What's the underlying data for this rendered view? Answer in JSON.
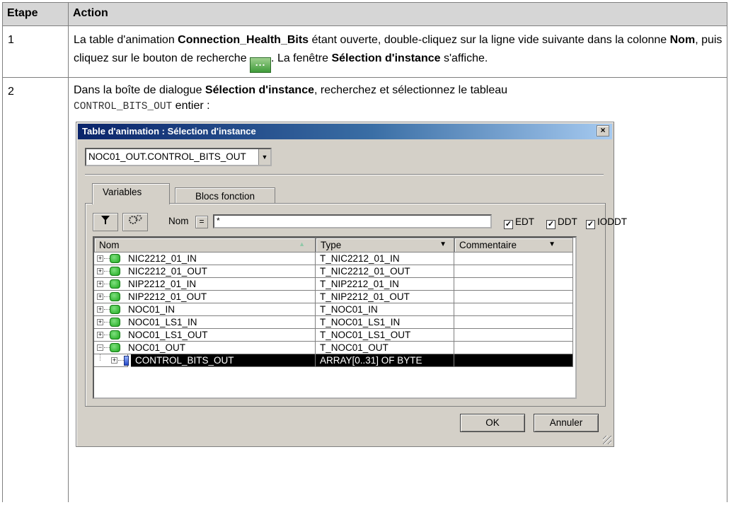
{
  "table": {
    "header": {
      "step": "Etape",
      "action": "Action"
    },
    "row1": {
      "step": "1",
      "t1": "La table d'animation ",
      "b1": "Connection_Health_Bits",
      "t2": " étant ouverte, double-cliquez sur la ligne vide suivante dans la colonne ",
      "b2": "Nom",
      "t3": ", puis cliquez sur le bouton de recherche ",
      "btn": "...",
      "t4": ". La fenêtre ",
      "b3": "Sélection d'instance",
      "t5": " s'affiche."
    },
    "row2": {
      "step": "2",
      "t1": "Dans la boîte de dialogue ",
      "b1": "Sélection d'instance",
      "t2": ", recherchez et sélectionnez le tableau",
      "code": "CONTROL_BITS_OUT",
      "t3": " entier :"
    }
  },
  "dialog": {
    "title": "Table d'animation : Sélection d'instance",
    "close": "×",
    "combo_value": "NOC01_OUT.CONTROL_BITS_OUT",
    "tabs": [
      "Variables",
      "Blocs fonction"
    ],
    "filter_label": "Nom",
    "eq_label": "=",
    "filter_value": "*",
    "checkboxes": [
      {
        "label": "EDT",
        "checked": true
      },
      {
        "label": "DDT",
        "checked": true
      },
      {
        "label": "IODDT",
        "checked": true
      }
    ],
    "columns": [
      "Nom",
      "Type",
      "Commentaire"
    ],
    "rows": [
      {
        "name": "NIC2212_01_IN",
        "type": "T_NIC2212_01_IN"
      },
      {
        "name": "NIC2212_01_OUT",
        "type": "T_NIC2212_01_OUT"
      },
      {
        "name": "NIP2212_01_IN",
        "type": "T_NIP2212_01_IN"
      },
      {
        "name": "NIP2212_01_OUT",
        "type": "T_NIP2212_01_OUT"
      },
      {
        "name": "NOC01_IN",
        "type": "T_NOC01_IN"
      },
      {
        "name": "NOC01_LS1_IN",
        "type": "T_NOC01_LS1_IN"
      },
      {
        "name": "NOC01_LS1_OUT",
        "type": "T_NOC01_LS1_OUT"
      },
      {
        "name": "NOC01_OUT",
        "type": "T_NOC01_OUT"
      },
      {
        "name": "CONTROL_BITS_OUT",
        "type": "ARRAY[0..31] OF BYTE"
      }
    ],
    "ok": "OK",
    "cancel": "Annuler"
  },
  "colors": {
    "header_bg": "#d6d6d6",
    "dialog_bg": "#d4d0c8",
    "title_start": "#0a246a",
    "title_end": "#a6caf0",
    "selection": "#000000"
  }
}
